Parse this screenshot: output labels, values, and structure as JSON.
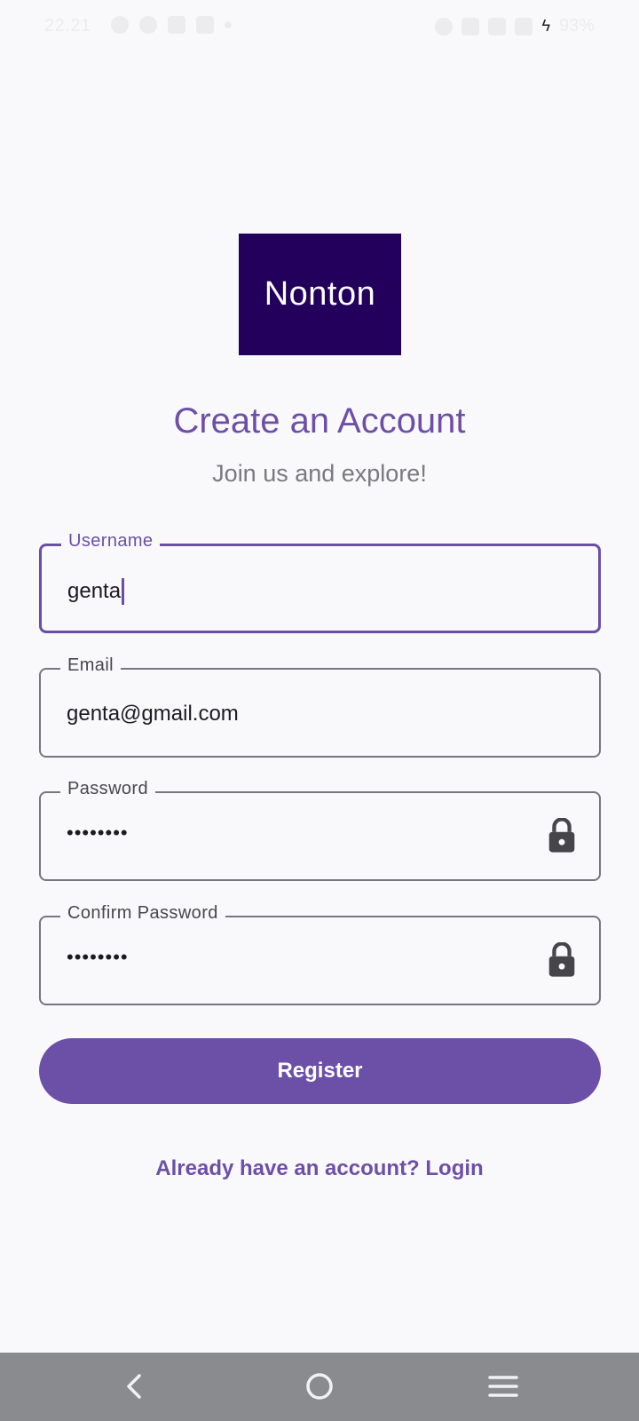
{
  "status_bar": {
    "time": "22.21",
    "battery": "93%"
  },
  "logo": {
    "text": "Nonton",
    "background_color": "#22005c"
  },
  "header": {
    "title": "Create an Account",
    "subtitle": "Join us and explore!"
  },
  "form": {
    "username": {
      "label": "Username",
      "value": "genta",
      "focused": true
    },
    "email": {
      "label": "Email",
      "value": "genta@gmail.com"
    },
    "password": {
      "label": "Password",
      "value": "••••••••",
      "icon": "lock-icon"
    },
    "confirm_password": {
      "label": "Confirm Password",
      "value": "••••••••",
      "icon": "lock-icon"
    }
  },
  "actions": {
    "register_label": "Register",
    "login_link": "Already have an account? Login"
  },
  "nav_bar": {
    "buttons": [
      "back-icon",
      "home-icon",
      "menu-icon"
    ]
  },
  "colors": {
    "accent": "#6c4fa7",
    "background": "#f9f9fb",
    "nav_bar": "#8a8b8f"
  }
}
